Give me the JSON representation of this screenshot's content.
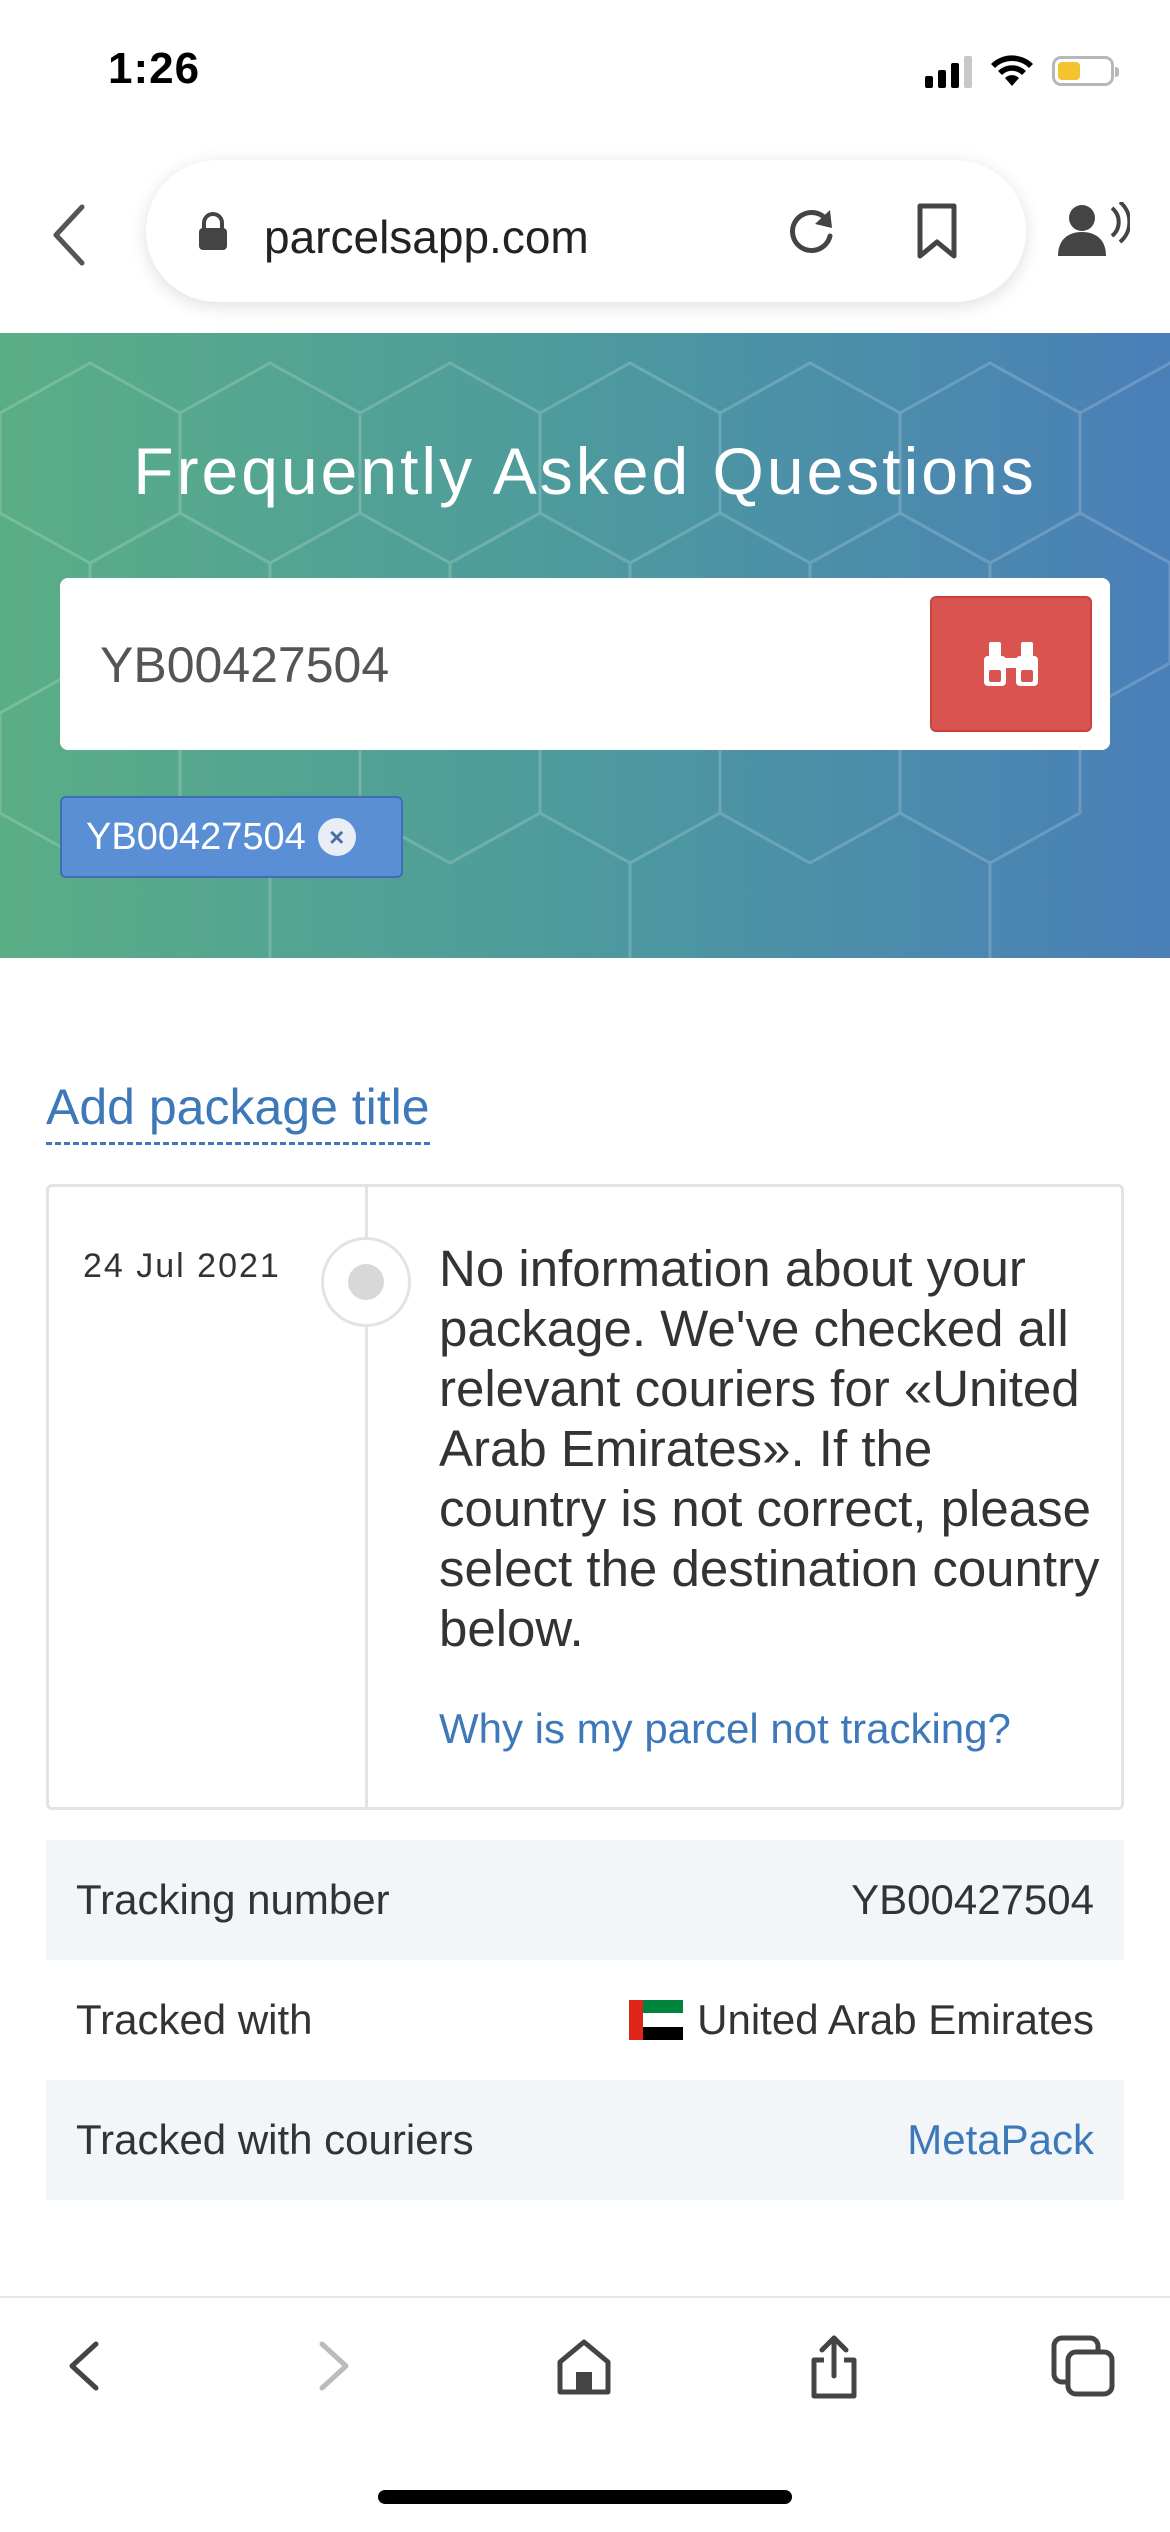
{
  "status_bar": {
    "time": "1:26",
    "battery_level": 0.44
  },
  "browser": {
    "url": "parcelsapp.com",
    "icons": [
      "back-icon",
      "lock-icon",
      "reload-icon",
      "bookmark-icon",
      "listen-icon"
    ]
  },
  "hero": {
    "title": "Frequently Asked Questions",
    "search_value": "YB00427504",
    "chip_label": "YB00427504",
    "chip_close": "×"
  },
  "main": {
    "package_title_link": "Add package title",
    "event": {
      "date": "24 Jul 2021",
      "message": "No information about your package. We've checked all relevant couriers for «United Arab Emirates». If the country is not correct, please select the destination country below.",
      "help_link": "Why is my parcel not tracking?"
    },
    "details": [
      {
        "label": "Tracking number",
        "value": "YB00427504"
      },
      {
        "label": "Tracked with",
        "value": "United Arab Emirates",
        "flag": "uae-flag"
      },
      {
        "label": "Tracked with couriers",
        "value": "MetaPack"
      }
    ]
  },
  "colors": {
    "accent_blue": "#3d78b9",
    "search_button_red": "#d9534f",
    "chip_blue": "#5a8fd6",
    "hero_gradient_start": "#5aae86",
    "hero_gradient_end": "#4a7fb8"
  },
  "bottom_nav": [
    "back-arrow-icon",
    "forward-arrow-icon",
    "home-icon",
    "share-icon",
    "tabs-icon"
  ]
}
